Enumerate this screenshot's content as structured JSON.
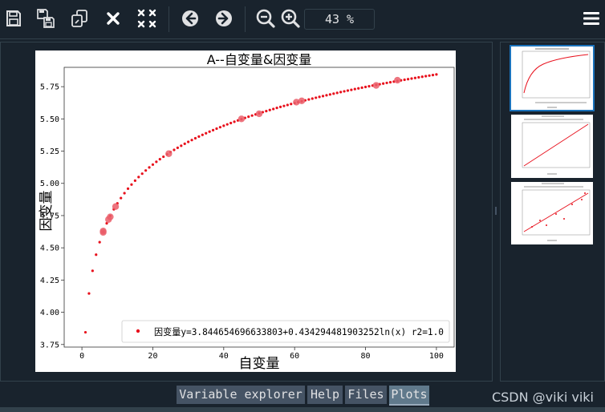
{
  "toolbar": {
    "buttons": [
      {
        "name": "save-icon",
        "title": "Save plot as"
      },
      {
        "name": "save-all-icon",
        "title": "Save all plots"
      },
      {
        "name": "copy-icon",
        "title": "Copy plot to clipboard"
      },
      {
        "name": "close-icon",
        "title": "Remove plot"
      },
      {
        "name": "close-all-icon",
        "title": "Remove all plots"
      },
      {
        "name": "arrow-left-icon",
        "title": "Previous plot"
      },
      {
        "name": "arrow-right-icon",
        "title": "Next plot"
      },
      {
        "name": "zoom-out-icon",
        "title": "Zoom out"
      },
      {
        "name": "zoom-in-icon",
        "title": "Zoom in"
      }
    ],
    "zoom_value": "43 %",
    "menu_icon": "hamburger-menu-icon"
  },
  "chart_data": {
    "type": "scatter",
    "title": "A--自变量&因变量",
    "xlabel": "自变量",
    "ylabel": "因变量",
    "xlim": [
      -5,
      105
    ],
    "ylim": [
      3.73,
      5.9
    ],
    "xticks": [
      "0",
      "20",
      "40",
      "60",
      "80",
      "100"
    ],
    "yticks": [
      "3.75",
      "4.00",
      "4.25",
      "4.50",
      "4.75",
      "5.00",
      "5.25",
      "5.50",
      "5.75"
    ],
    "curve": {
      "a": 3.844654696633803,
      "b": 0.434294481903252,
      "x_from": 1,
      "x_to": 100,
      "color": "#e8101c"
    },
    "highlight_points": [
      {
        "x": 6,
        "y": 4.63
      },
      {
        "x": 6,
        "y": 4.62
      },
      {
        "x": 7.5,
        "y": 4.72
      },
      {
        "x": 8,
        "y": 4.74
      },
      {
        "x": 9.5,
        "y": 4.82
      },
      {
        "x": 24.5,
        "y": 5.23
      },
      {
        "x": 45,
        "y": 5.5
      },
      {
        "x": 50,
        "y": 5.54
      },
      {
        "x": 60.5,
        "y": 5.63
      },
      {
        "x": 62,
        "y": 5.64
      },
      {
        "x": 83,
        "y": 5.76
      },
      {
        "x": 89,
        "y": 5.8
      }
    ],
    "highlight_color": "#ea5e6a",
    "legend": {
      "label": "因变量y=3.844654696633803+0.434294481903252ln(x)  r2=1.0",
      "position": "lower-right"
    }
  },
  "thumbnails": [
    {
      "selected": true
    },
    {
      "selected": false
    },
    {
      "selected": false
    }
  ],
  "tabs": [
    {
      "label": "Variable explorer",
      "active": false
    },
    {
      "label": "Help",
      "active": false
    },
    {
      "label": "Files",
      "active": false
    },
    {
      "label": "Plots",
      "active": true
    }
  ],
  "watermark": "CSDN @viki viki",
  "colors": {
    "accent": "#1a72bb",
    "background": "#19232d",
    "border": "#32414b"
  }
}
